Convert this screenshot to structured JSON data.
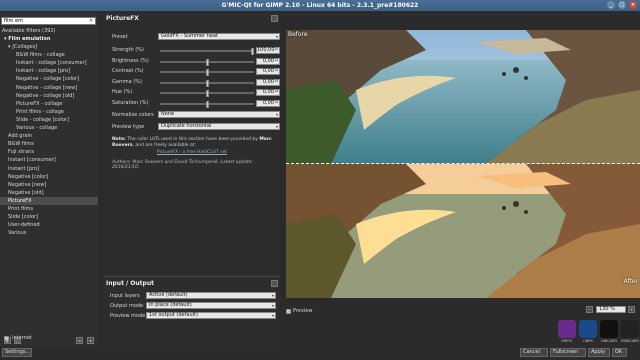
{
  "window": {
    "title": "G'MIC-Qt for GIMP 2.10 - Linux 64 bits - 2.3.1_pre#180622"
  },
  "left": {
    "search_value": "film em",
    "available": "Available filters (392)",
    "tree": [
      {
        "label": "▾ Film emulation",
        "indent": 1,
        "bold": true
      },
      {
        "label": "▾ [Collages]",
        "indent": 2,
        "italic": true
      },
      {
        "label": "B&W films - collage",
        "indent": 4
      },
      {
        "label": "Instant - collage [consumer]",
        "indent": 4
      },
      {
        "label": "Instant - collage [pro]",
        "indent": 4
      },
      {
        "label": "Negative - collage [color]",
        "indent": 4
      },
      {
        "label": "Negative - collage [new]",
        "indent": 4
      },
      {
        "label": "Negative - collage [old]",
        "indent": 4
      },
      {
        "label": "PictureFX - collage",
        "indent": 4
      },
      {
        "label": "Print films - collage",
        "indent": 4
      },
      {
        "label": "Slide - collage [color]",
        "indent": 4
      },
      {
        "label": "Various - collage",
        "indent": 4
      },
      {
        "label": "Add grain",
        "indent": 2
      },
      {
        "label": "B&W films",
        "indent": 2
      },
      {
        "label": "Fuji xtrans",
        "indent": 2
      },
      {
        "label": "Instant [consumer]",
        "indent": 2
      },
      {
        "label": "Instant [pro]",
        "indent": 2
      },
      {
        "label": "Negative [color]",
        "indent": 2
      },
      {
        "label": "Negative [new]",
        "indent": 2
      },
      {
        "label": "Negative [old]",
        "indent": 2
      },
      {
        "label": "PictureFX",
        "indent": 2,
        "selected": true
      },
      {
        "label": "Print films",
        "indent": 2
      },
      {
        "label": "Slide [color]",
        "indent": 2
      },
      {
        "label": "User-defined",
        "indent": 2
      },
      {
        "label": "Various",
        "indent": 2
      }
    ],
    "internet_label": "Internet",
    "settings_label": "Settings..."
  },
  "filter": {
    "title": "PictureFX",
    "preset_label": "Preset",
    "preset_value": "GoldFX - Summer heat",
    "params": [
      {
        "label": "Strength (%)",
        "value": "100,00",
        "level": 1.0
      },
      {
        "label": "Brightness (%)",
        "value": "0,00",
        "level": 0.5
      },
      {
        "label": "Contrast (%)",
        "value": "0,00",
        "level": 0.5
      },
      {
        "label": "Gamma (%)",
        "value": "0,00",
        "level": 0.5
      },
      {
        "label": "Hue (%)",
        "value": "0,00",
        "level": 0.5
      },
      {
        "label": "Saturation (%)",
        "value": "0,00",
        "level": 0.5
      }
    ],
    "normalize_label": "Normalize colors",
    "normalize_value": "None",
    "preview_type_label": "Preview type",
    "preview_type_value": "Duplicate horizontal",
    "note_bold": "Note:",
    "note_text": " The color LUTs used in this section have been provided by ",
    "note_author": "Marc Roovers",
    "note_end": ", and are freely available at:",
    "link": "PictureFX - a free HaldCLUT set",
    "authors": "Authors: Marc Roovers and David Tschumperlé. Latest update: 2016/21/10."
  },
  "io": {
    "title": "Input / Output",
    "rows": [
      {
        "label": "Input layers",
        "value": "Active (default)"
      },
      {
        "label": "Output mode",
        "value": "In place (default)"
      },
      {
        "label": "Preview mode",
        "value": "1st output (default)"
      }
    ]
  },
  "preview": {
    "before_label": "Before",
    "after_label": "After",
    "preview_checkbox": "Preview",
    "zoom_value": "130 %"
  },
  "logos": [
    {
      "label": "GREYC",
      "color": "#6a2a8a"
    },
    {
      "label": "CNRS",
      "color": "#1a4a8a"
    },
    {
      "label": "UNICAEN",
      "color": "#111111"
    },
    {
      "label": "ENSICAEN",
      "color": "#222222"
    }
  ],
  "buttons": {
    "cancel": "Cancel",
    "fullscreen": "Fullscreen",
    "apply": "Apply",
    "ok": "OK"
  }
}
